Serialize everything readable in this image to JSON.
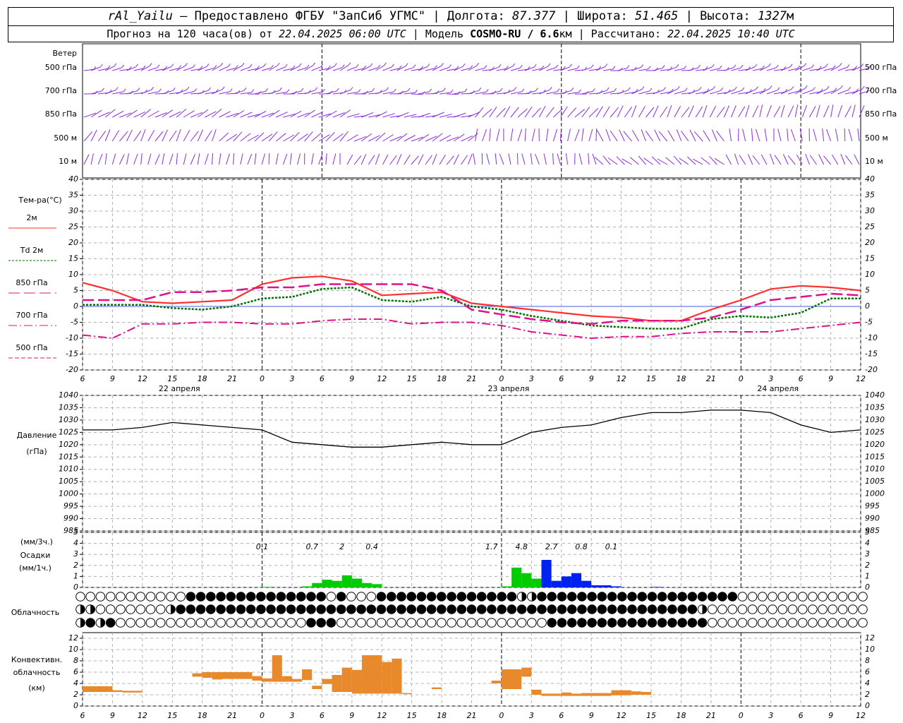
{
  "header": {
    "station": "rAl_Yailu",
    "dash": " – ",
    "provider": "Предоставлено ФГБУ \"ЗапСиб УГМС\"",
    "lon_label": "Долгота: ",
    "lon_value": "87.377",
    "lat_label": "Широта: ",
    "lat_value": "51.465",
    "alt_label": "Высота: ",
    "alt_value": "1327",
    "alt_unit": "м",
    "sep": " | ",
    "forecast_label": "Прогноз на 120 часа(ов) от ",
    "forecast_time": "22.04.2025 06:00 UTC",
    "model_label": " | Модель ",
    "model_name": "COSMO-RU / 6.6",
    "model_unit": "км",
    "calc_label": " | Рассчитано: ",
    "calc_time": "22.04.2025 10:40 UTC"
  },
  "wind": {
    "title": "Ветер",
    "levels": [
      "500 гПа",
      "700 гПа",
      "850 гПа",
      "500 м",
      "10  м"
    ]
  },
  "temp": {
    "title": "Тем-ра(°C)",
    "legend": [
      {
        "label": "2м",
        "color": "#ff3030"
      },
      {
        "label": "Td 2м",
        "color": "#007000"
      },
      {
        "label": "850 гПа",
        "color": "#e0108a"
      },
      {
        "label": "700 гПа",
        "color": "#e0108a"
      },
      {
        "label": "500 гПа",
        "color": "#e0108a"
      }
    ]
  },
  "pressure": {
    "title": "Давление",
    "unit": "(гПа)"
  },
  "precip": {
    "title": "Осадки",
    "unit3": "(мм/3ч.)",
    "unit1": "(мм/1ч.)"
  },
  "cloud": {
    "title": "Облачность"
  },
  "conv": {
    "title1": "Конвективн.",
    "title2": "облачность",
    "unit": "(км)"
  },
  "days": [
    "22 апреля",
    "23 апреля",
    "24 апреля"
  ],
  "colors": {
    "t2m": "#ff3030",
    "td": "#007000",
    "upper": "#e0108a",
    "wind": "#8a2be2",
    "rain": "#00cc00",
    "snow": "#0022ee",
    "conv": "#e8892b",
    "grid": "#b0b0b0"
  },
  "chart_data": [
    {
      "type": "line",
      "title": "Тем-ра(°C)",
      "x_hours_from_start": [
        0,
        3,
        6,
        9,
        12,
        15,
        18,
        21,
        24,
        27,
        30,
        33,
        36,
        39,
        42,
        45,
        48,
        51,
        54,
        57,
        60,
        63,
        66,
        69,
        72,
        75,
        78
      ],
      "x_tick_labels": [
        "6",
        "9",
        "12",
        "15",
        "18",
        "21",
        "0",
        "3",
        "6",
        "9",
        "12",
        "15",
        "18",
        "21",
        "0",
        "3",
        "6",
        "9",
        "12",
        "15",
        "18",
        "21",
        "0",
        "3",
        "6",
        "9",
        "12"
      ],
      "ylim": [
        -20,
        40
      ],
      "y_ticks": [
        -20,
        -15,
        -10,
        -5,
        0,
        5,
        10,
        15,
        20,
        25,
        30,
        35,
        40
      ],
      "series": [
        {
          "name": "2м",
          "values": [
            7.5,
            5,
            1.5,
            1,
            1.5,
            2,
            7,
            9,
            9.5,
            8,
            3.5,
            4,
            4.5,
            1,
            0,
            -1,
            -2,
            -3,
            -3.5,
            -4.5,
            -4.5,
            -1,
            2,
            5.5,
            6.5,
            6,
            5
          ]
        },
        {
          "name": "Td 2м",
          "values": [
            0.5,
            0.5,
            0.5,
            -0.5,
            -1,
            0,
            2.5,
            3,
            5.5,
            6,
            2,
            1.5,
            3,
            0,
            -1,
            -3,
            -4.5,
            -6,
            -6.5,
            -7,
            -7,
            -4,
            -3,
            -3.5,
            -2,
            2.5,
            2.5
          ]
        },
        {
          "name": "850 гПа",
          "values": [
            2,
            2,
            2,
            4.5,
            4.5,
            5,
            6,
            6,
            7,
            7,
            7,
            7,
            5,
            -1,
            -2.5,
            -4,
            -5,
            -5.5,
            -4.5,
            -4.5,
            -4.5,
            -3.5,
            -1,
            2,
            3,
            4,
            3.5
          ]
        },
        {
          "name": "500 гПа",
          "values": [
            -9,
            -10,
            -5.5,
            -5.5,
            -5,
            -5,
            -5.5,
            -5.5,
            -4.5,
            -4,
            -4,
            -5.5,
            -5,
            -5,
            -6,
            -8,
            -9,
            -10,
            -9.5,
            -9.5,
            -8.5,
            -8,
            -8,
            -8,
            -7,
            -6,
            -5
          ]
        }
      ]
    },
    {
      "type": "line",
      "title": "Давление",
      "ylabel": "(гПа)",
      "ylim": [
        985,
        1040
      ],
      "y_ticks": [
        985,
        990,
        995,
        1000,
        1005,
        1010,
        1015,
        1020,
        1025,
        1030,
        1035,
        1040
      ],
      "series": [
        {
          "name": "Давление",
          "values": [
            1026,
            1026,
            1027,
            1029,
            1028,
            1027,
            1026,
            1021,
            1020,
            1019,
            1019,
            1020,
            1021,
            1020,
            1020,
            1025,
            1027,
            1028,
            1031,
            1033,
            1033,
            1034,
            1034,
            1033,
            1028,
            1025,
            1026
          ]
        }
      ]
    },
    {
      "type": "bar",
      "title": "Осадки",
      "ylabel": "(мм/1ч.)",
      "ylim": [
        0,
        5
      ],
      "labels_3h": [
        "0.1",
        "0.7",
        "2",
        "0.4",
        "1.7",
        "4.8",
        "2.7",
        "0.8",
        "0.1"
      ],
      "hourly_rain_mm": [
        {
          "h": 18,
          "v": 0.05
        },
        {
          "h": 22,
          "v": 0.1
        },
        {
          "h": 23,
          "v": 0.4
        },
        {
          "h": 24,
          "v": 0.7
        },
        {
          "h": 25,
          "v": 0.6
        },
        {
          "h": 26,
          "v": 1.1
        },
        {
          "h": 27,
          "v": 0.8
        },
        {
          "h": 28,
          "v": 0.4
        },
        {
          "h": 29,
          "v": 0.3
        },
        {
          "h": 42,
          "v": 0.1
        },
        {
          "h": 43,
          "v": 1.8
        },
        {
          "h": 44,
          "v": 1.3
        },
        {
          "h": 45,
          "v": 0.8
        },
        {
          "h": 46,
          "v": 0.5
        }
      ],
      "hourly_snow_mm": [
        {
          "h": 46,
          "v": 2.5
        },
        {
          "h": 47,
          "v": 0.6
        },
        {
          "h": 48,
          "v": 1.0
        },
        {
          "h": 49,
          "v": 1.3
        },
        {
          "h": 50,
          "v": 0.6
        },
        {
          "h": 51,
          "v": 0.2
        },
        {
          "h": 52,
          "v": 0.2
        },
        {
          "h": 53,
          "v": 0.1
        },
        {
          "h": 57,
          "v": 0.05
        }
      ]
    },
    {
      "type": "bar",
      "title": "Конвективн. облачность",
      "ylabel": "(км)",
      "ylim": [
        0,
        13
      ],
      "y_ticks": [
        0,
        2,
        4,
        6,
        8,
        10,
        12
      ],
      "bars": [
        {
          "h0": 0,
          "h1": 3,
          "bottom": 2.5,
          "top": 3.5
        },
        {
          "h0": 3,
          "h1": 4,
          "bottom": 2.5,
          "top": 2.8
        },
        {
          "h0": 4,
          "h1": 6,
          "bottom": 2.4,
          "top": 2.7
        },
        {
          "h0": 11,
          "h1": 12,
          "bottom": 5.2,
          "top": 5.8
        },
        {
          "h0": 12,
          "h1": 13,
          "bottom": 5.0,
          "top": 6.0
        },
        {
          "h0": 13,
          "h1": 14,
          "bottom": 4.7,
          "top": 6.0
        },
        {
          "h0": 14,
          "h1": 17,
          "bottom": 4.8,
          "top": 6.0
        },
        {
          "h0": 17,
          "h1": 18,
          "bottom": 4.5,
          "top": 5.3
        },
        {
          "h0": 18,
          "h1": 19,
          "bottom": 4.3,
          "top": 4.9
        },
        {
          "h0": 19,
          "h1": 20,
          "bottom": 4.3,
          "top": 9.0
        },
        {
          "h0": 20,
          "h1": 21,
          "bottom": 4.3,
          "top": 5.3
        },
        {
          "h0": 21,
          "h1": 22,
          "bottom": 4.3,
          "top": 4.8
        },
        {
          "h0": 22,
          "h1": 23,
          "bottom": 4.6,
          "top": 6.5
        },
        {
          "h0": 23,
          "h1": 24,
          "bottom": 3.0,
          "top": 3.6
        },
        {
          "h0": 24,
          "h1": 25,
          "bottom": 3.9,
          "top": 4.8
        },
        {
          "h0": 25,
          "h1": 26,
          "bottom": 2.5,
          "top": 5.5
        },
        {
          "h0": 26,
          "h1": 27,
          "bottom": 2.5,
          "top": 6.8
        },
        {
          "h0": 27,
          "h1": 28,
          "bottom": 2.2,
          "top": 6.4
        },
        {
          "h0": 28,
          "h1": 30,
          "bottom": 2.2,
          "top": 9.0
        },
        {
          "h0": 30,
          "h1": 31,
          "bottom": 2.2,
          "top": 7.8
        },
        {
          "h0": 31,
          "h1": 32,
          "bottom": 2.2,
          "top": 8.4
        },
        {
          "h0": 32,
          "h1": 33,
          "bottom": 2.1,
          "top": 2.3
        },
        {
          "h0": 35,
          "h1": 36,
          "bottom": 3.0,
          "top": 3.3
        },
        {
          "h0": 41,
          "h1": 42,
          "bottom": 4.0,
          "top": 4.5
        },
        {
          "h0": 42,
          "h1": 44,
          "bottom": 3.0,
          "top": 6.5
        },
        {
          "h0": 44,
          "h1": 45,
          "bottom": 5.2,
          "top": 6.8
        },
        {
          "h0": 45,
          "h1": 46,
          "bottom": 2.0,
          "top": 2.9
        },
        {
          "h0": 46,
          "h1": 48,
          "bottom": 1.8,
          "top": 2.2
        },
        {
          "h0": 48,
          "h1": 49,
          "bottom": 1.8,
          "top": 2.4
        },
        {
          "h0": 49,
          "h1": 50,
          "bottom": 1.8,
          "top": 2.2
        },
        {
          "h0": 50,
          "h1": 53,
          "bottom": 1.8,
          "top": 2.3
        },
        {
          "h0": 53,
          "h1": 55,
          "bottom": 1.9,
          "top": 2.8
        },
        {
          "h0": 55,
          "h1": 56,
          "bottom": 2.0,
          "top": 2.6
        },
        {
          "h0": 56,
          "h1": 57,
          "bottom": 2.0,
          "top": 2.5
        }
      ]
    },
    {
      "type": "table",
      "title": "Облачность",
      "levels": [
        "upper",
        "middle",
        "low"
      ],
      "rows": [
        "000000000000000000000000000000000000000111111110000000000000000000000000111111111111111000000000000000000000000000000000",
        "222222222200000000000000000000000000000000000000000000000000000000000000000000000000000000000000000000000000000000000000",
        "000000000000000000000000000000000000000000000000000000000000000000000000000000000000000000000000000000000000000000000000"
      ]
    }
  ]
}
